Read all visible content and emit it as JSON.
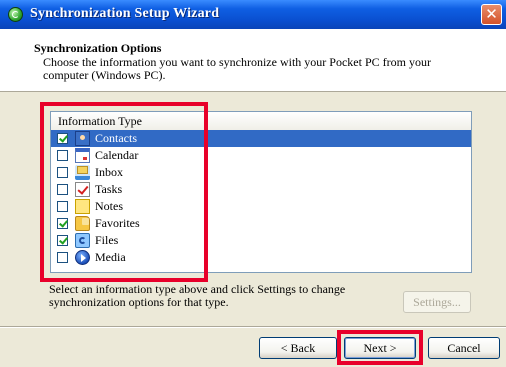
{
  "window": {
    "title": "Synchronization Setup Wizard",
    "close_glyph": "✕",
    "icon": "sync-app-icon"
  },
  "header": {
    "title": "Synchronization Options",
    "description": "Choose the information you want to synchronize with your Pocket PC from your computer (Windows PC)."
  },
  "list": {
    "column_header": "Information Type",
    "items": [
      {
        "label": "Contacts",
        "checked": true,
        "selected": true,
        "icon": "contacts-icon"
      },
      {
        "label": "Calendar",
        "checked": false,
        "selected": false,
        "icon": "calendar-icon"
      },
      {
        "label": "Inbox",
        "checked": false,
        "selected": false,
        "icon": "inbox-icon"
      },
      {
        "label": "Tasks",
        "checked": false,
        "selected": false,
        "icon": "tasks-icon"
      },
      {
        "label": "Notes",
        "checked": false,
        "selected": false,
        "icon": "notes-icon"
      },
      {
        "label": "Favorites",
        "checked": true,
        "selected": false,
        "icon": "favorites-icon"
      },
      {
        "label": "Files",
        "checked": true,
        "selected": false,
        "icon": "files-icon"
      },
      {
        "label": "Media",
        "checked": false,
        "selected": false,
        "icon": "media-icon"
      }
    ]
  },
  "hint": "Select an information type above and click Settings to change synchronization options for that type.",
  "buttons": {
    "settings": "Settings...",
    "back": "< Back",
    "next": "Next >",
    "cancel": "Cancel"
  },
  "colors": {
    "title_bar": "#0a4fd0",
    "selection": "#316ac5",
    "highlight_box": "#e8002a"
  }
}
